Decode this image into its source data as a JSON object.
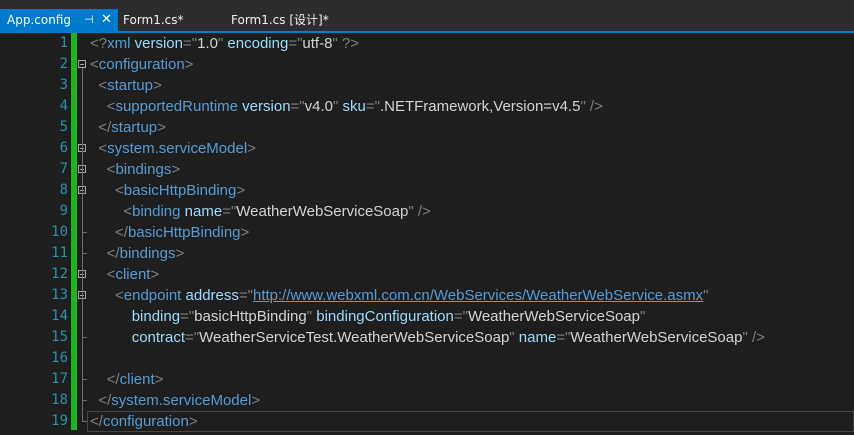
{
  "tabs": [
    {
      "label": "App.config",
      "active": true,
      "pin_icon": "pin-icon",
      "close_icon": "close-icon"
    },
    {
      "label": "Form1.cs*",
      "active": false
    },
    {
      "label": "Form1.cs [设计]*",
      "active": false
    }
  ],
  "editor": {
    "line_numbers": [
      "1",
      "2",
      "3",
      "4",
      "5",
      "6",
      "7",
      "8",
      "9",
      "10",
      "11",
      "12",
      "13",
      "14",
      "15",
      "16",
      "17",
      "18",
      "19"
    ],
    "lines": [
      [
        {
          "c": "d",
          "t": "<?"
        },
        {
          "c": "e",
          "t": "xml"
        },
        {
          "c": "a",
          "t": " version"
        },
        {
          "c": "d",
          "t": "=\""
        },
        {
          "c": "v",
          "t": "1.0"
        },
        {
          "c": "d",
          "t": "\""
        },
        {
          "c": "a",
          "t": " encoding"
        },
        {
          "c": "d",
          "t": "=\""
        },
        {
          "c": "v",
          "t": "utf-8"
        },
        {
          "c": "d",
          "t": "\" ?>"
        }
      ],
      [
        {
          "c": "d",
          "t": "<"
        },
        {
          "c": "e",
          "t": "configuration"
        },
        {
          "c": "d",
          "t": ">"
        }
      ],
      [
        {
          "c": "t",
          "t": "  "
        },
        {
          "c": "d",
          "t": "<"
        },
        {
          "c": "e",
          "t": "startup"
        },
        {
          "c": "d",
          "t": ">"
        }
      ],
      [
        {
          "c": "t",
          "t": "    "
        },
        {
          "c": "d",
          "t": "<"
        },
        {
          "c": "e",
          "t": "supportedRuntime"
        },
        {
          "c": "a",
          "t": " version"
        },
        {
          "c": "d",
          "t": "=\""
        },
        {
          "c": "v",
          "t": "v4.0"
        },
        {
          "c": "d",
          "t": "\""
        },
        {
          "c": "a",
          "t": " sku"
        },
        {
          "c": "d",
          "t": "=\""
        },
        {
          "c": "v",
          "t": ".NETFramework,Version=v4.5"
        },
        {
          "c": "d",
          "t": "\" />"
        }
      ],
      [
        {
          "c": "t",
          "t": "  "
        },
        {
          "c": "d",
          "t": "</"
        },
        {
          "c": "e",
          "t": "startup"
        },
        {
          "c": "d",
          "t": ">"
        }
      ],
      [
        {
          "c": "t",
          "t": "  "
        },
        {
          "c": "d",
          "t": "<"
        },
        {
          "c": "e",
          "t": "system.serviceModel"
        },
        {
          "c": "d",
          "t": ">"
        }
      ],
      [
        {
          "c": "t",
          "t": "    "
        },
        {
          "c": "d",
          "t": "<"
        },
        {
          "c": "e",
          "t": "bindings"
        },
        {
          "c": "d",
          "t": ">"
        }
      ],
      [
        {
          "c": "t",
          "t": "      "
        },
        {
          "c": "d",
          "t": "<"
        },
        {
          "c": "e",
          "t": "basicHttpBinding"
        },
        {
          "c": "d",
          "t": ">"
        }
      ],
      [
        {
          "c": "t",
          "t": "        "
        },
        {
          "c": "d",
          "t": "<"
        },
        {
          "c": "e",
          "t": "binding"
        },
        {
          "c": "a",
          "t": " name"
        },
        {
          "c": "d",
          "t": "=\""
        },
        {
          "c": "v",
          "t": "WeatherWebServiceSoap"
        },
        {
          "c": "d",
          "t": "\" />"
        }
      ],
      [
        {
          "c": "t",
          "t": "      "
        },
        {
          "c": "d",
          "t": "</"
        },
        {
          "c": "e",
          "t": "basicHttpBinding"
        },
        {
          "c": "d",
          "t": ">"
        }
      ],
      [
        {
          "c": "t",
          "t": "    "
        },
        {
          "c": "d",
          "t": "</"
        },
        {
          "c": "e",
          "t": "bindings"
        },
        {
          "c": "d",
          "t": ">"
        }
      ],
      [
        {
          "c": "t",
          "t": "    "
        },
        {
          "c": "d",
          "t": "<"
        },
        {
          "c": "e",
          "t": "client"
        },
        {
          "c": "d",
          "t": ">"
        }
      ],
      [
        {
          "c": "t",
          "t": "      "
        },
        {
          "c": "d",
          "t": "<"
        },
        {
          "c": "e",
          "t": "endpoint"
        },
        {
          "c": "a",
          "t": " address"
        },
        {
          "c": "d",
          "t": "=\""
        },
        {
          "c": "u",
          "t": "http://www.webxml.com.cn/WebServices/WeatherWebService.asmx"
        },
        {
          "c": "d",
          "t": "\""
        }
      ],
      [
        {
          "c": "t",
          "t": "          "
        },
        {
          "c": "a",
          "t": "binding"
        },
        {
          "c": "d",
          "t": "=\""
        },
        {
          "c": "v",
          "t": "basicHttpBinding"
        },
        {
          "c": "d",
          "t": "\""
        },
        {
          "c": "a",
          "t": " bindingConfiguration"
        },
        {
          "c": "d",
          "t": "=\""
        },
        {
          "c": "v",
          "t": "WeatherWebServiceSoap"
        },
        {
          "c": "d",
          "t": "\""
        }
      ],
      [
        {
          "c": "t",
          "t": "          "
        },
        {
          "c": "a",
          "t": "contract"
        },
        {
          "c": "d",
          "t": "=\""
        },
        {
          "c": "v",
          "t": "WeatherServiceTest.WeatherWebServiceSoap"
        },
        {
          "c": "d",
          "t": "\""
        },
        {
          "c": "a",
          "t": " name"
        },
        {
          "c": "d",
          "t": "=\""
        },
        {
          "c": "v",
          "t": "WeatherWebServiceSoap"
        },
        {
          "c": "d",
          "t": "\" />"
        }
      ],
      [],
      [
        {
          "c": "t",
          "t": "    "
        },
        {
          "c": "d",
          "t": "</"
        },
        {
          "c": "e",
          "t": "client"
        },
        {
          "c": "d",
          "t": ">"
        }
      ],
      [
        {
          "c": "t",
          "t": "  "
        },
        {
          "c": "d",
          "t": "</"
        },
        {
          "c": "e",
          "t": "system.serviceModel"
        },
        {
          "c": "d",
          "t": ">"
        }
      ],
      [
        {
          "c": "d",
          "t": "</"
        },
        {
          "c": "e",
          "t": "configuration"
        },
        {
          "c": "d",
          "t": ">"
        }
      ]
    ],
    "fold_lines": [
      2,
      6,
      7,
      8,
      12,
      13
    ]
  },
  "colors": {
    "accent": "#007acc",
    "changebar": "#1fb41f",
    "line_number": "#2b91af",
    "element": "#569cd6",
    "attribute": "#9cdcfe"
  }
}
